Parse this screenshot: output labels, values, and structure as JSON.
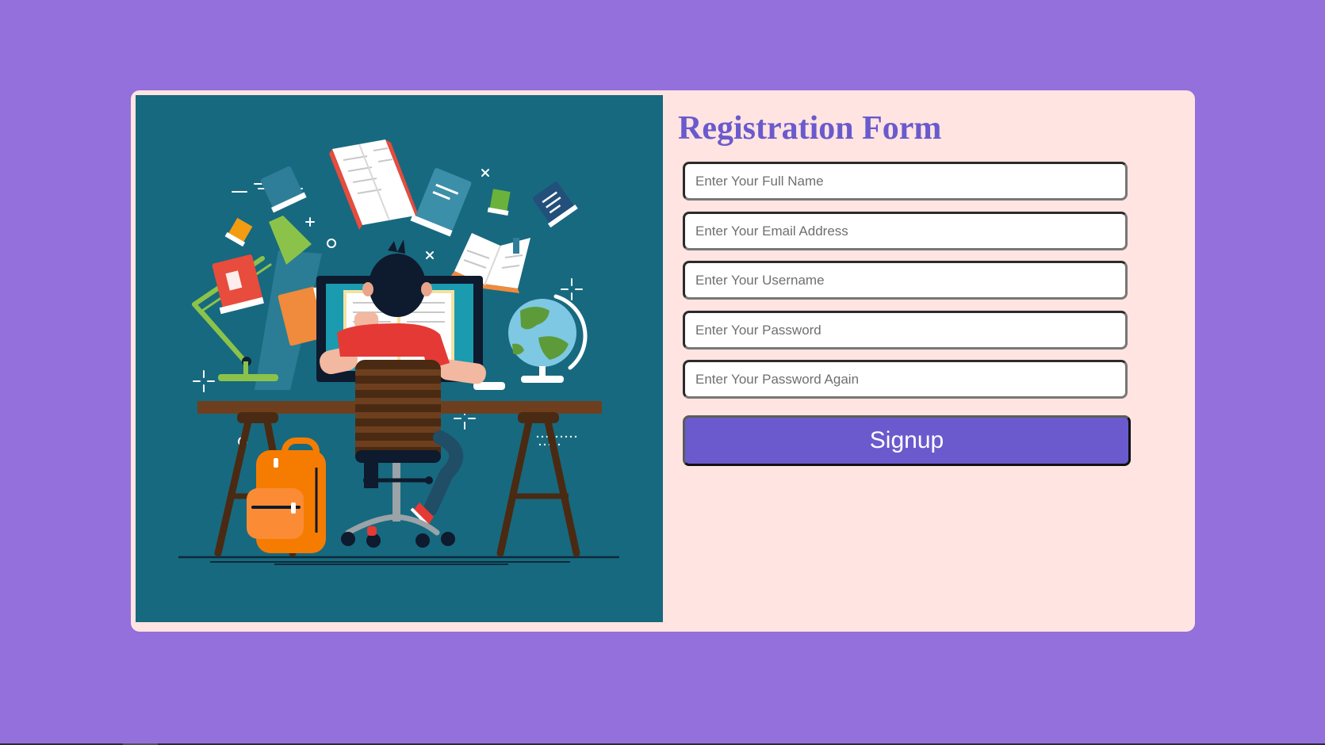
{
  "form": {
    "title": "Registration Form",
    "fields": [
      {
        "name": "full-name",
        "type": "text",
        "placeholder": "Enter Your Full Name",
        "value": ""
      },
      {
        "name": "email",
        "type": "email",
        "placeholder": "Enter Your Email Address",
        "value": ""
      },
      {
        "name": "username",
        "type": "text",
        "placeholder": "Enter Your Username",
        "value": ""
      },
      {
        "name": "password",
        "type": "password",
        "placeholder": "Enter Your Password",
        "value": ""
      },
      {
        "name": "password-again",
        "type": "password",
        "placeholder": "Enter Your Password Again",
        "value": ""
      }
    ],
    "submit_label": "Signup"
  },
  "illustration": {
    "subject": "student-at-desk-illustration"
  },
  "colors": {
    "page_background": "#9370db",
    "card_background": "#ffe4e1",
    "illustration_background": "#17697f",
    "title": "#6a5acd",
    "button": "#6a5acd",
    "button_text": "#ffffff"
  }
}
